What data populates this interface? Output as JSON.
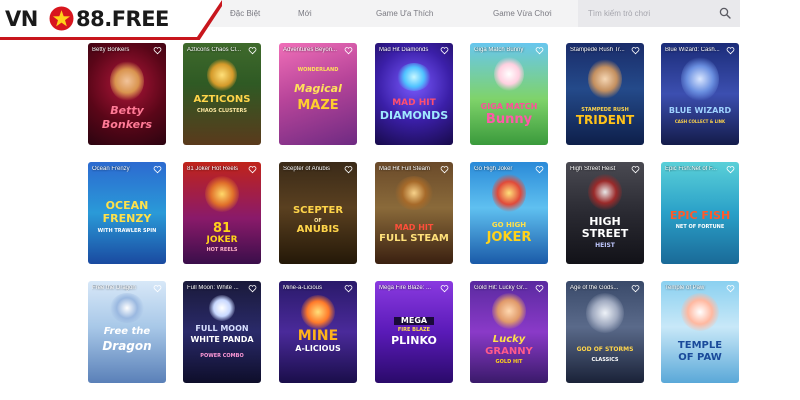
{
  "brand": {
    "logo_left": "VN",
    "logo_right": "88.FREE"
  },
  "nav": {
    "tabs": [
      {
        "label": "Đặc Biệt"
      },
      {
        "label": "Mới"
      },
      {
        "label": "Game Ưa Thích"
      },
      {
        "label": "Game Vừa Chơi"
      }
    ]
  },
  "search": {
    "placeholder": "Tìm kiếm trò chơi"
  },
  "games": [
    {
      "title": "Betty Bonkers",
      "art": [
        "Betty",
        "Bonkers"
      ],
      "sub": ""
    },
    {
      "title": "Azticons Chaos Cl...",
      "art": [
        "AZTICONS"
      ],
      "sub": "CHAOS CLUSTERS"
    },
    {
      "title": "Adventures Beyon...",
      "art": [
        "Magical",
        "MAZE"
      ],
      "sub": "WONDERLAND"
    },
    {
      "title": "Mad Hit Diamonds",
      "art": [
        "MAD HIT",
        "DIAMONDS"
      ],
      "sub": ""
    },
    {
      "title": "Giga Match Bunny",
      "art": [
        "GIGA MATCH",
        "Bunny"
      ],
      "sub": ""
    },
    {
      "title": "Stampede Rush Tr...",
      "art": [
        "TRIDENT"
      ],
      "sub": "STAMPEDE RUSH"
    },
    {
      "title": "Blue Wizard: Cash...",
      "art": [
        "BLUE WIZARD"
      ],
      "sub": "CASH COLLECT & LINK"
    },
    {
      "title": "Ocean Frenzy",
      "art": [
        "OCEAN",
        "FRENZY"
      ],
      "sub": "WITH TRAWLER SPIN"
    },
    {
      "title": "81 Joker Hot Reels",
      "art": [
        "81",
        "JOKER"
      ],
      "sub": "HOT REELS"
    },
    {
      "title": "Scepter of Anubis",
      "art": [
        "SCEPTER",
        "ANUBIS"
      ],
      "sub": "OF"
    },
    {
      "title": "Mad Hit Full Steam",
      "art": [
        "MAD HIT",
        "FULL STEAM"
      ],
      "sub": ""
    },
    {
      "title": "Go High Joker",
      "art": [
        "GO HIGH",
        "JOKER"
      ],
      "sub": ""
    },
    {
      "title": "High Street Heist",
      "art": [
        "HIGH",
        "STREET"
      ],
      "sub": "HEIST"
    },
    {
      "title": "Epic Fish:Net of F...",
      "art": [
        "EPIC FISH"
      ],
      "sub": "NET OF FORTUNE"
    },
    {
      "title": "Free the Dragon",
      "art": [
        "Free the",
        "Dragon"
      ],
      "sub": ""
    },
    {
      "title": "Full Moon: White ...",
      "art": [
        "FULL MOON",
        "WHITE PANDA"
      ],
      "sub": "POWER COMBO"
    },
    {
      "title": "Mine-a-Licious",
      "art": [
        "MINE",
        "A-LICIOUS"
      ],
      "sub": ""
    },
    {
      "title": "Mega Fire Blaze: ...",
      "art": [
        "MEGA",
        "PLINKO"
      ],
      "sub": "FIRE BLAZE"
    },
    {
      "title": "Gold Hit: Lucky Gr...",
      "art": [
        "Lucky",
        "GRANNY"
      ],
      "sub": "GOLD HIT"
    },
    {
      "title": "Age of the Gods...",
      "art": [
        "GOD OF STORMS"
      ],
      "sub": "CLASSICS"
    },
    {
      "title": "Temple of Paw",
      "art": [
        "TEMPLE",
        "OF PAW"
      ],
      "sub": ""
    }
  ]
}
